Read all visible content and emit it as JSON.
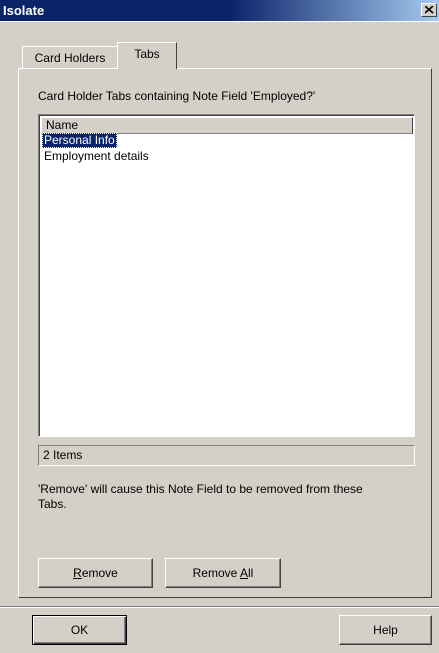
{
  "window": {
    "title": "Isolate",
    "close_label": "X"
  },
  "tabs": [
    {
      "label": "Card Holders",
      "active": false
    },
    {
      "label": "Tabs",
      "active": true
    }
  ],
  "panel": {
    "heading": "Card Holder Tabs containing Note Field 'Employed?'",
    "list": {
      "column_header": "Name",
      "rows": [
        {
          "label": "Personal Info",
          "selected": true
        },
        {
          "label": "Employment details",
          "selected": false
        }
      ]
    },
    "status": "2 Items",
    "note": "'Remove' will cause this Note Field to be removed from these Tabs.",
    "buttons": {
      "remove": {
        "pre": "",
        "key": "R",
        "post": "emove"
      },
      "remove_all": {
        "pre": "Remove ",
        "key": "A",
        "post": "ll"
      }
    }
  },
  "footer": {
    "ok_label": "OK",
    "help_label": "Help"
  },
  "colors": {
    "titlebar": "#0a246a",
    "selection": "#0a246a",
    "face": "#d4d0c8"
  }
}
